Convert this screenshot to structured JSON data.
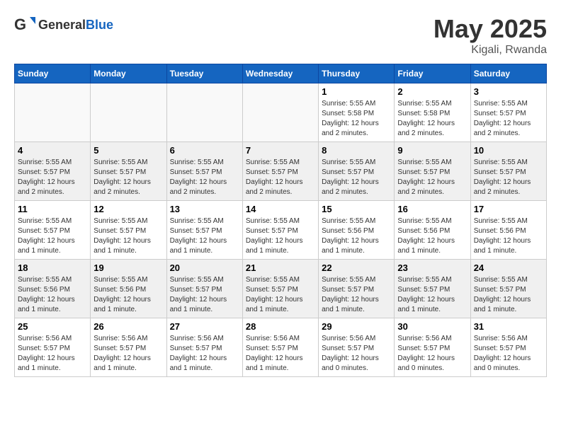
{
  "header": {
    "logo_general": "General",
    "logo_blue": "Blue",
    "month_year": "May 2025",
    "location": "Kigali, Rwanda"
  },
  "days_of_week": [
    "Sunday",
    "Monday",
    "Tuesday",
    "Wednesday",
    "Thursday",
    "Friday",
    "Saturday"
  ],
  "weeks": [
    [
      {
        "day": "",
        "info": ""
      },
      {
        "day": "",
        "info": ""
      },
      {
        "day": "",
        "info": ""
      },
      {
        "day": "",
        "info": ""
      },
      {
        "day": "1",
        "info": "Sunrise: 5:55 AM\nSunset: 5:58 PM\nDaylight: 12 hours\nand 2 minutes."
      },
      {
        "day": "2",
        "info": "Sunrise: 5:55 AM\nSunset: 5:58 PM\nDaylight: 12 hours\nand 2 minutes."
      },
      {
        "day": "3",
        "info": "Sunrise: 5:55 AM\nSunset: 5:57 PM\nDaylight: 12 hours\nand 2 minutes."
      }
    ],
    [
      {
        "day": "4",
        "info": "Sunrise: 5:55 AM\nSunset: 5:57 PM\nDaylight: 12 hours\nand 2 minutes."
      },
      {
        "day": "5",
        "info": "Sunrise: 5:55 AM\nSunset: 5:57 PM\nDaylight: 12 hours\nand 2 minutes."
      },
      {
        "day": "6",
        "info": "Sunrise: 5:55 AM\nSunset: 5:57 PM\nDaylight: 12 hours\nand 2 minutes."
      },
      {
        "day": "7",
        "info": "Sunrise: 5:55 AM\nSunset: 5:57 PM\nDaylight: 12 hours\nand 2 minutes."
      },
      {
        "day": "8",
        "info": "Sunrise: 5:55 AM\nSunset: 5:57 PM\nDaylight: 12 hours\nand 2 minutes."
      },
      {
        "day": "9",
        "info": "Sunrise: 5:55 AM\nSunset: 5:57 PM\nDaylight: 12 hours\nand 2 minutes."
      },
      {
        "day": "10",
        "info": "Sunrise: 5:55 AM\nSunset: 5:57 PM\nDaylight: 12 hours\nand 2 minutes."
      }
    ],
    [
      {
        "day": "11",
        "info": "Sunrise: 5:55 AM\nSunset: 5:57 PM\nDaylight: 12 hours\nand 1 minute."
      },
      {
        "day": "12",
        "info": "Sunrise: 5:55 AM\nSunset: 5:57 PM\nDaylight: 12 hours\nand 1 minute."
      },
      {
        "day": "13",
        "info": "Sunrise: 5:55 AM\nSunset: 5:57 PM\nDaylight: 12 hours\nand 1 minute."
      },
      {
        "day": "14",
        "info": "Sunrise: 5:55 AM\nSunset: 5:57 PM\nDaylight: 12 hours\nand 1 minute."
      },
      {
        "day": "15",
        "info": "Sunrise: 5:55 AM\nSunset: 5:56 PM\nDaylight: 12 hours\nand 1 minute."
      },
      {
        "day": "16",
        "info": "Sunrise: 5:55 AM\nSunset: 5:56 PM\nDaylight: 12 hours\nand 1 minute."
      },
      {
        "day": "17",
        "info": "Sunrise: 5:55 AM\nSunset: 5:56 PM\nDaylight: 12 hours\nand 1 minute."
      }
    ],
    [
      {
        "day": "18",
        "info": "Sunrise: 5:55 AM\nSunset: 5:56 PM\nDaylight: 12 hours\nand 1 minute."
      },
      {
        "day": "19",
        "info": "Sunrise: 5:55 AM\nSunset: 5:56 PM\nDaylight: 12 hours\nand 1 minute."
      },
      {
        "day": "20",
        "info": "Sunrise: 5:55 AM\nSunset: 5:57 PM\nDaylight: 12 hours\nand 1 minute."
      },
      {
        "day": "21",
        "info": "Sunrise: 5:55 AM\nSunset: 5:57 PM\nDaylight: 12 hours\nand 1 minute."
      },
      {
        "day": "22",
        "info": "Sunrise: 5:55 AM\nSunset: 5:57 PM\nDaylight: 12 hours\nand 1 minute."
      },
      {
        "day": "23",
        "info": "Sunrise: 5:55 AM\nSunset: 5:57 PM\nDaylight: 12 hours\nand 1 minute."
      },
      {
        "day": "24",
        "info": "Sunrise: 5:55 AM\nSunset: 5:57 PM\nDaylight: 12 hours\nand 1 minute."
      }
    ],
    [
      {
        "day": "25",
        "info": "Sunrise: 5:56 AM\nSunset: 5:57 PM\nDaylight: 12 hours\nand 1 minute."
      },
      {
        "day": "26",
        "info": "Sunrise: 5:56 AM\nSunset: 5:57 PM\nDaylight: 12 hours\nand 1 minute."
      },
      {
        "day": "27",
        "info": "Sunrise: 5:56 AM\nSunset: 5:57 PM\nDaylight: 12 hours\nand 1 minute."
      },
      {
        "day": "28",
        "info": "Sunrise: 5:56 AM\nSunset: 5:57 PM\nDaylight: 12 hours\nand 1 minute."
      },
      {
        "day": "29",
        "info": "Sunrise: 5:56 AM\nSunset: 5:57 PM\nDaylight: 12 hours\nand 0 minutes."
      },
      {
        "day": "30",
        "info": "Sunrise: 5:56 AM\nSunset: 5:57 PM\nDaylight: 12 hours\nand 0 minutes."
      },
      {
        "day": "31",
        "info": "Sunrise: 5:56 AM\nSunset: 5:57 PM\nDaylight: 12 hours\nand 0 minutes."
      }
    ]
  ]
}
